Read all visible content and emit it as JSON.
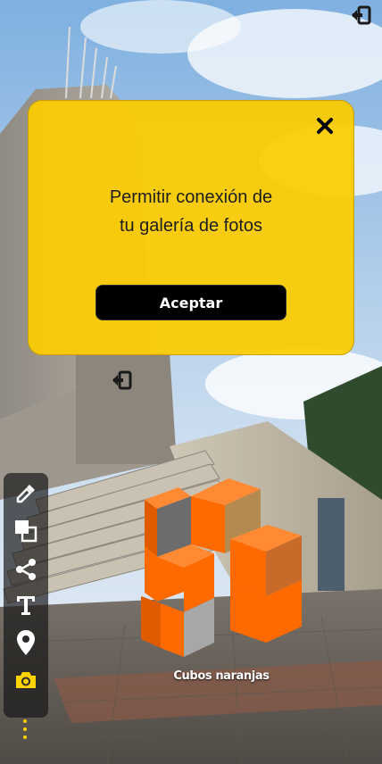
{
  "dialog": {
    "message_line1": "Permitir conexión de",
    "message_line2": "tu galería de fotos",
    "accept_label": "Aceptar",
    "close_icon": "close-icon"
  },
  "artwork": {
    "caption": "Cubos naranjas"
  },
  "toolbar": {
    "items": [
      {
        "icon": "eyedropper-icon"
      },
      {
        "icon": "layers-icon"
      },
      {
        "icon": "share-icon"
      },
      {
        "icon": "text-icon"
      },
      {
        "icon": "location-pin-icon"
      },
      {
        "icon": "camera-icon",
        "active": true
      }
    ],
    "more_icon": "more-vertical-icon"
  },
  "exit_icon": "exit-icon",
  "colors": {
    "dialog_bg": "#fdcc00",
    "accent": "#ffd200",
    "cube_orange": "#ff6a00",
    "toolbar_bg": "#141414"
  }
}
